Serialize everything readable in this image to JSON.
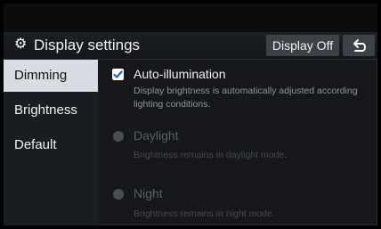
{
  "header": {
    "title": "Display settings",
    "display_off_label": "Display Off",
    "back_icon": "back-arrow-icon",
    "settings_icon": "gear-icon"
  },
  "sidebar": {
    "items": [
      {
        "label": "Dimming",
        "active": true
      },
      {
        "label": "Brightness",
        "active": false
      },
      {
        "label": "Default",
        "active": false
      }
    ]
  },
  "options": {
    "auto": {
      "label": "Auto-illumination",
      "desc_line1": "Display brightness is automatically adjusted according",
      "desc_line2": "lighting conditions.",
      "checked": true
    },
    "daylight": {
      "label": "Daylight",
      "desc": "Brightness remains in daylight mode.",
      "enabled": false
    },
    "night": {
      "label": "Night",
      "desc": "Brightness remains in night mode.",
      "enabled": false
    }
  },
  "colors": {
    "accent_selected_bg": "#d9dce2",
    "panel_bg": "#15171b",
    "button_bg": "#3c4047"
  }
}
